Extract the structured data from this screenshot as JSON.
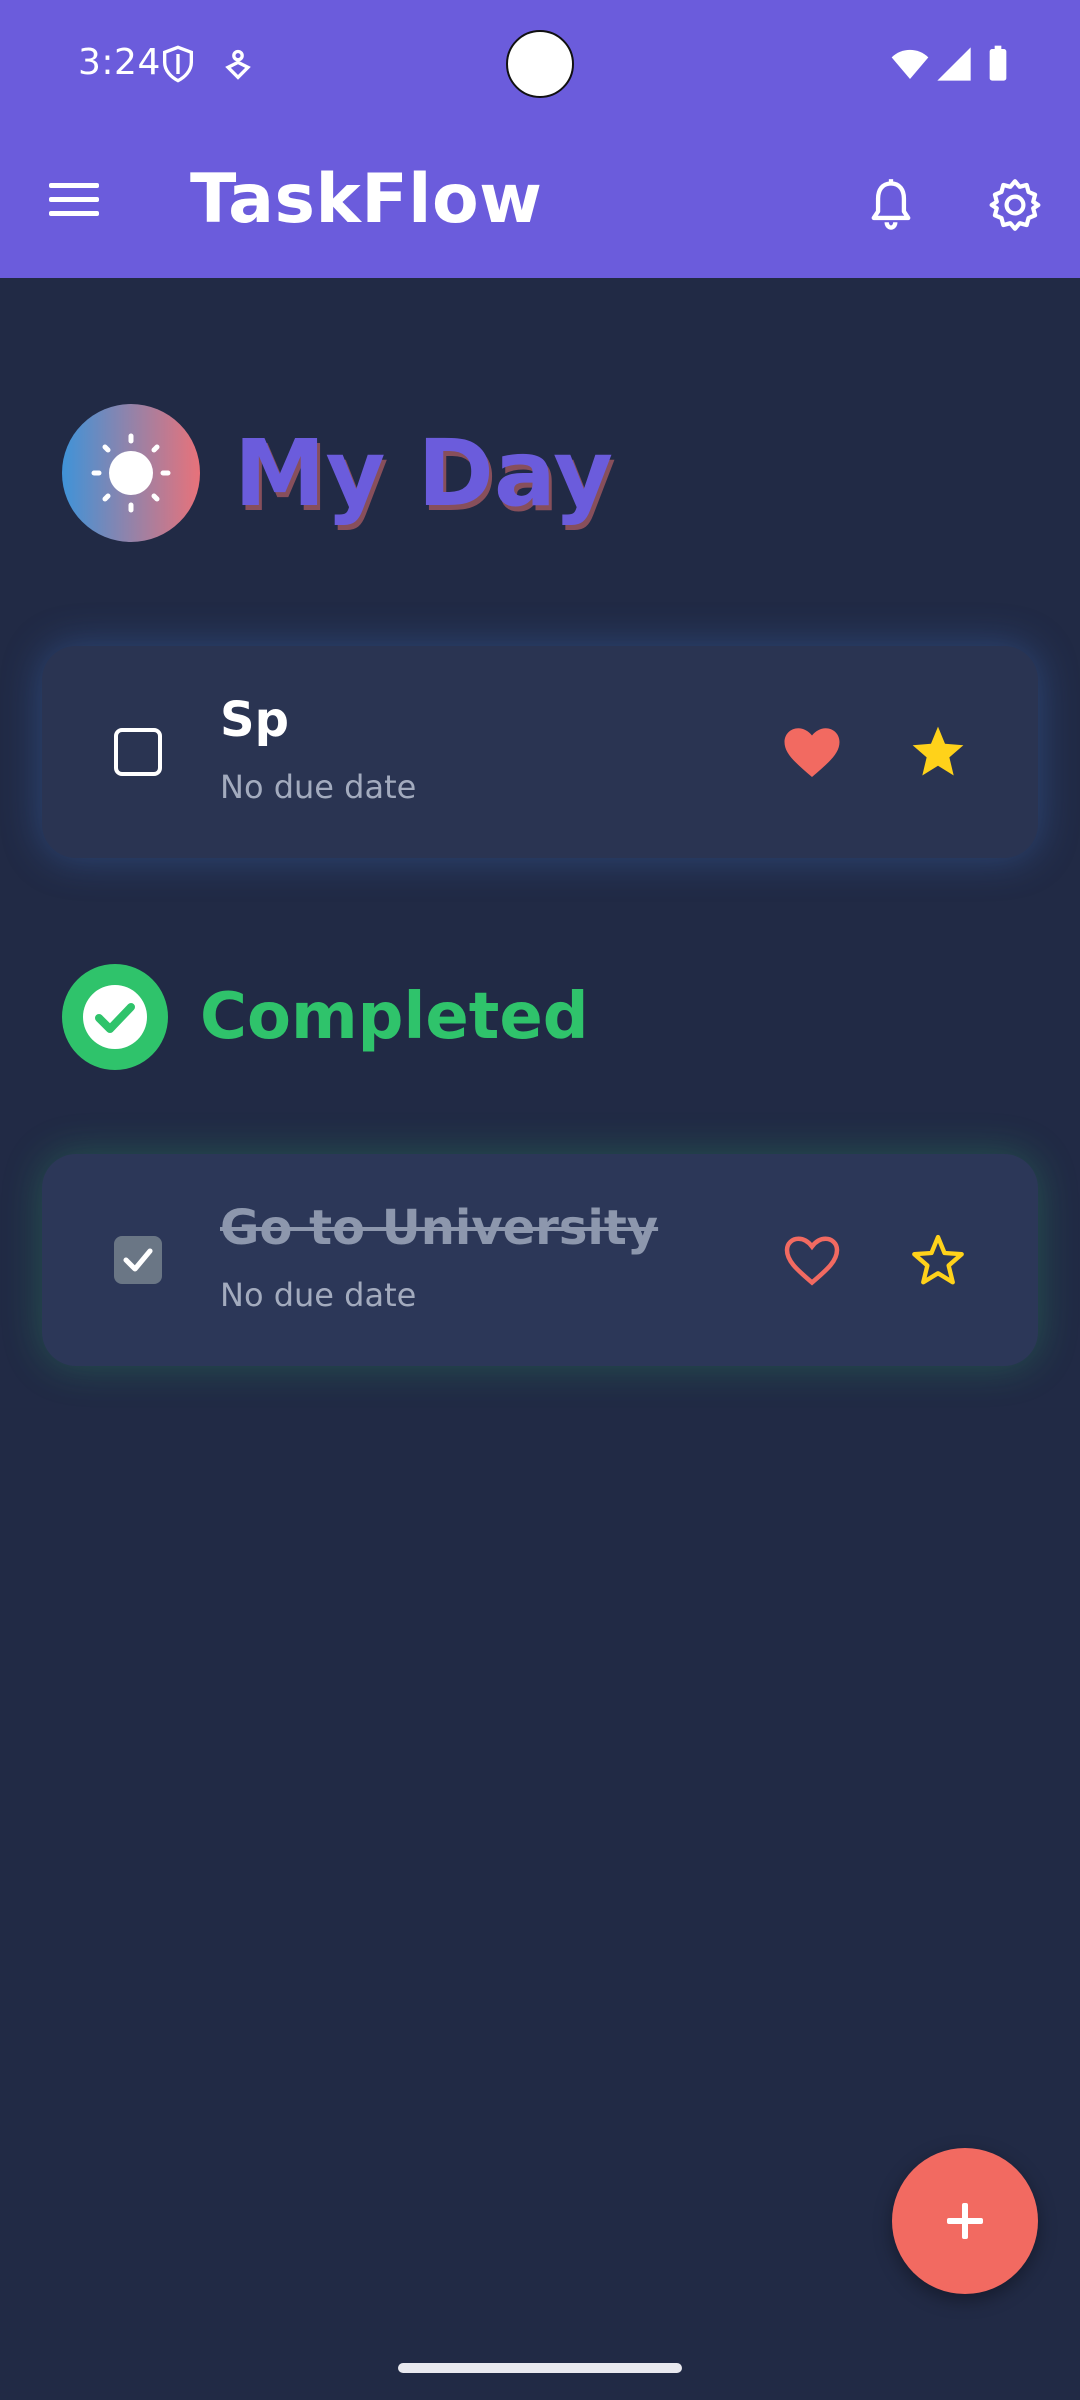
{
  "status_bar": {
    "time": "3:24",
    "icons": [
      "shield-icon",
      "navigation-icon",
      "wifi-icon",
      "signal-icon",
      "battery-icon"
    ]
  },
  "app_bar": {
    "title": "TaskFlow",
    "icons": [
      "menu-icon",
      "bell-icon",
      "gear-icon"
    ]
  },
  "sections": {
    "my_day": {
      "title": "My Day",
      "icon": "sun-icon",
      "tasks": [
        {
          "title": "Sp",
          "subtitle": "No due date",
          "completed": false,
          "favorite": true,
          "starred": true
        }
      ]
    },
    "completed": {
      "title": "Completed",
      "icon": "check-circle-icon",
      "tasks": [
        {
          "title": "Go to University",
          "subtitle": "No due date",
          "completed": true,
          "favorite": false,
          "starred": false
        }
      ]
    }
  },
  "fab": {
    "icon": "plus-icon"
  },
  "colors": {
    "app_bar": "#6b5cdc",
    "background": "#212a45",
    "card": "#2a3452",
    "completed_green": "#2fc36b",
    "heart_red": "#f26a61",
    "star_yellow": "#ffd21a"
  }
}
